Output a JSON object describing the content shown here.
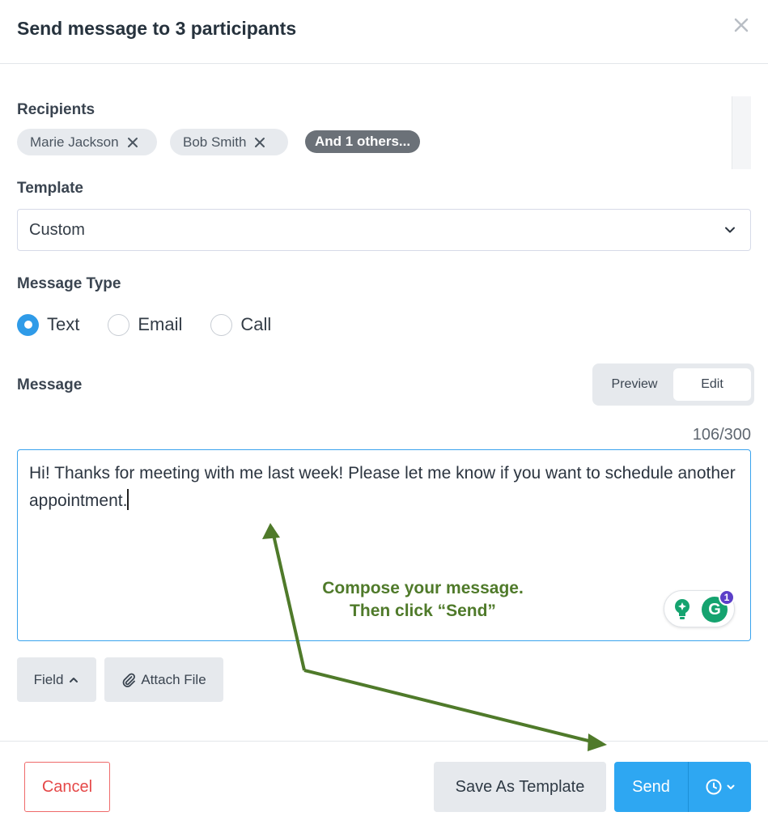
{
  "dialog": {
    "title": "Send message to 3 participants"
  },
  "recipients": {
    "label": "Recipients",
    "chips": [
      "Marie Jackson",
      "Bob Smith"
    ],
    "more_label": "And 1 others..."
  },
  "template": {
    "label": "Template",
    "selected": "Custom"
  },
  "message_type": {
    "label": "Message Type",
    "options": [
      "Text",
      "Email",
      "Call"
    ],
    "selected": "Text"
  },
  "message": {
    "label": "Message",
    "toggle": {
      "preview": "Preview",
      "edit": "Edit",
      "active": "Edit"
    },
    "counter": "106/300",
    "body": "Hi!  Thanks for meeting with me last week! Please let me know if you want to schedule another appointment."
  },
  "grammarly": {
    "badge_count": "1",
    "letter": "G"
  },
  "annotation": {
    "line1": "Compose your message.",
    "line2": "Then click “Send”",
    "color": "#4f7a2a"
  },
  "toolbar": {
    "field_label": "Field",
    "attach_label": "Attach File"
  },
  "footer": {
    "cancel_label": "Cancel",
    "save_template_label": "Save As Template",
    "send_label": "Send"
  },
  "colors": {
    "accent": "#2ea7f2",
    "danger": "#e54848",
    "chip_dark": "#6b7178"
  }
}
